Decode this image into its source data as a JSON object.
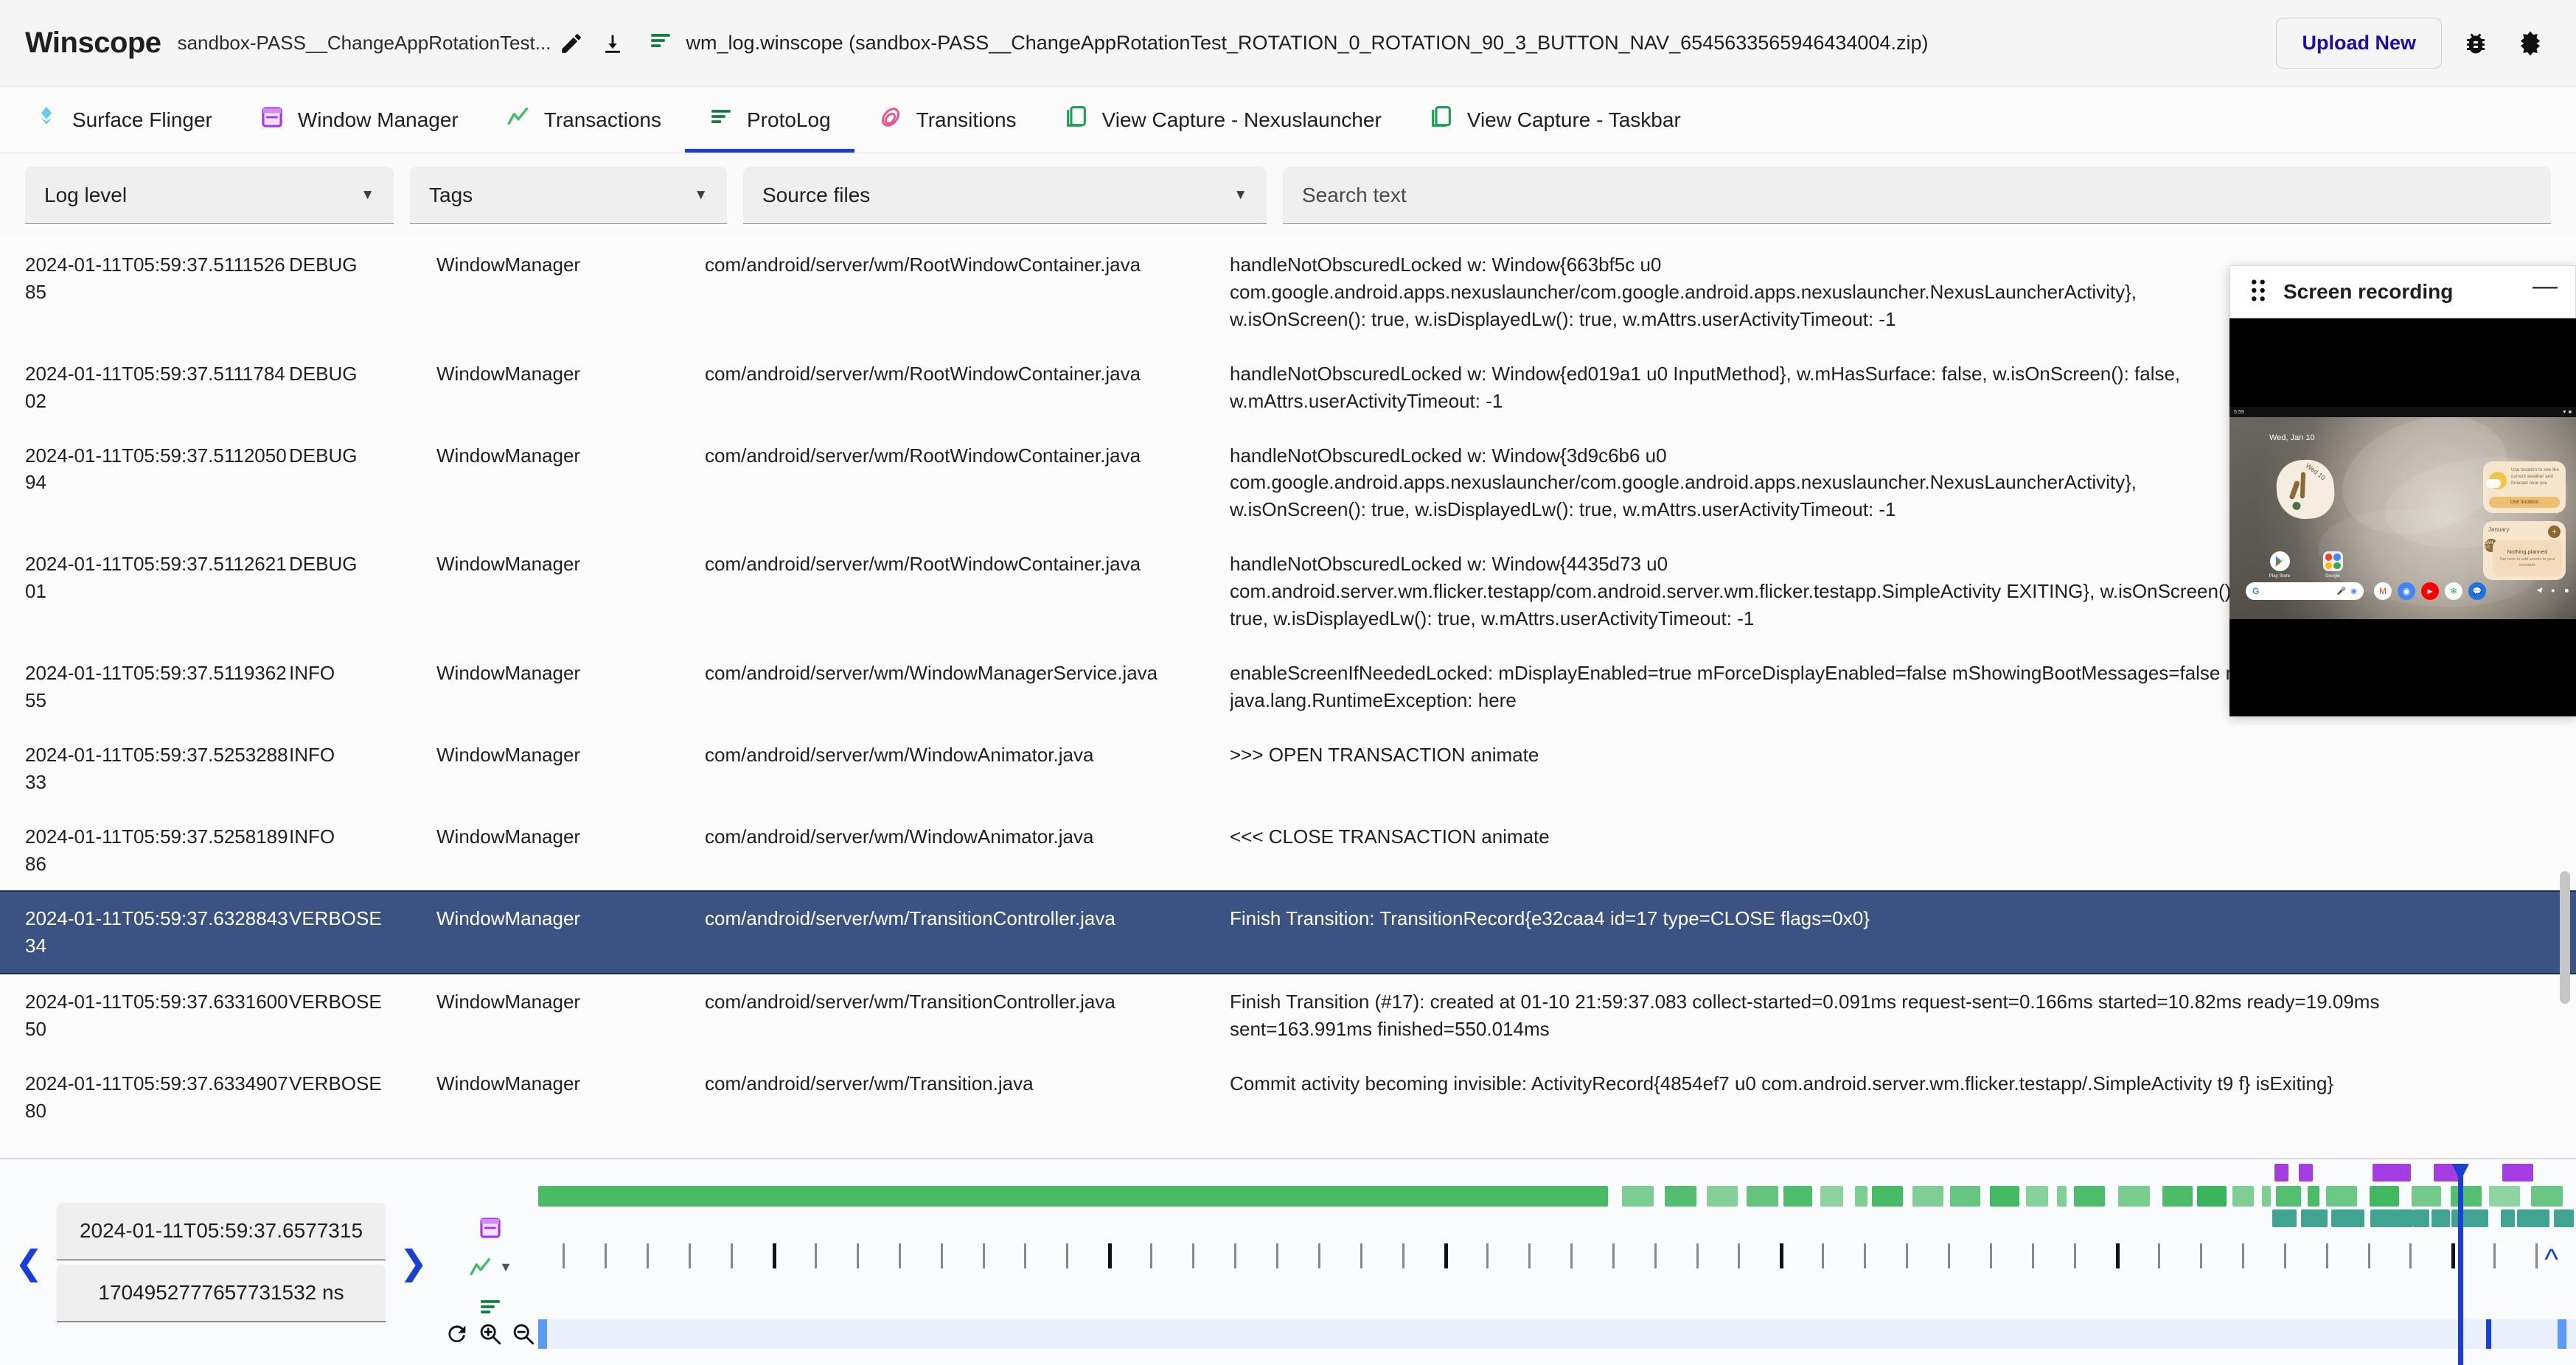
{
  "app": {
    "brand": "Winscope",
    "filename_chip": "sandbox-PASS__ChangeAppRotationTest...",
    "center_title": "wm_log.winscope (sandbox-PASS__ChangeAppRotationTest_ROTATION_0_ROTATION_90_3_BUTTON_NAV_6545633565946434004.zip)",
    "upload_label": "Upload New",
    "edit_icon": "pencil-icon",
    "download_icon": "download-icon",
    "bug_icon": "bug-report-icon",
    "theme_icon": "dark-mode-icon",
    "protolog_icon": "protolog-lines-icon"
  },
  "tabs": [
    {
      "label": "Surface Flinger",
      "icon": "surface-flinger-icon",
      "active": false
    },
    {
      "label": "Window Manager",
      "icon": "window-manager-icon",
      "active": false
    },
    {
      "label": "Transactions",
      "icon": "transactions-icon",
      "active": false
    },
    {
      "label": "ProtoLog",
      "icon": "protolog-icon",
      "active": true
    },
    {
      "label": "Transitions",
      "icon": "transitions-icon",
      "active": false
    },
    {
      "label": "View Capture - Nexuslauncher",
      "icon": "view-capture-icon",
      "active": false
    },
    {
      "label": "View Capture - Taskbar",
      "icon": "view-capture-icon",
      "active": false
    }
  ],
  "filters": {
    "log_level": "Log level",
    "tags": "Tags",
    "source_files": "Source files",
    "search_placeholder": "Search text",
    "search_value": ""
  },
  "log": {
    "rows": [
      {
        "time": "2024-01-11T05:59:37.511152685",
        "level": "DEBUG",
        "tag": "WindowManager",
        "source": "com/android/server/wm/RootWindowContainer.java",
        "message_lines": [
          "handleNotObscuredLocked w: Window{663bf5c u0",
          "com.google.android.apps.nexuslauncher/com.google.android.apps.nexuslauncher.NexusLauncherActivity},",
          "w.isOnScreen(): true, w.isDisplayedLw(): true, w.mAttrs.userActivityTimeout: -1"
        ],
        "selected": false
      },
      {
        "time": "2024-01-11T05:59:37.511178402",
        "level": "DEBUG",
        "tag": "WindowManager",
        "source": "com/android/server/wm/RootWindowContainer.java",
        "message_lines": [
          "handleNotObscuredLocked w: Window{ed019a1 u0 InputMethod}, w.mHasSurface: false, w.isOnScreen(): false,",
          "w.mAttrs.userActivityTimeout: -1"
        ],
        "selected": false
      },
      {
        "time": "2024-01-11T05:59:37.511205094",
        "level": "DEBUG",
        "tag": "WindowManager",
        "source": "com/android/server/wm/RootWindowContainer.java",
        "message_lines": [
          "handleNotObscuredLocked w: Window{3d9c6b6 u0",
          "com.google.android.apps.nexuslauncher/com.google.android.apps.nexuslauncher.NexusLauncherActivity},",
          "w.isOnScreen(): true, w.isDisplayedLw(): true, w.mAttrs.userActivityTimeout: -1"
        ],
        "selected": false
      },
      {
        "time": "2024-01-11T05:59:37.511262101",
        "level": "DEBUG",
        "tag": "WindowManager",
        "source": "com/android/server/wm/RootWindowContainer.java",
        "message_lines": [
          "handleNotObscuredLocked w: Window{4435d73 u0",
          "com.android.server.wm.flicker.testapp/com.android.server.wm.flicker.testapp.SimpleActivity EXITING}, w.isOnScreen():",
          "true, w.isDisplayedLw(): true, w.mAttrs.userActivityTimeout: -1"
        ],
        "selected": false
      },
      {
        "time": "2024-01-11T05:59:37.511936255",
        "level": "INFO",
        "tag": "WindowManager",
        "source": "com/android/server/wm/WindowManagerService.java",
        "message_lines": [
          "enableScreenIfNeededLocked: mDisplayEnabled=true mForceDisplayEnabled=false mShowingBootMessages=false mSystemBooted=true",
          "java.lang.RuntimeException: here"
        ],
        "selected": false
      },
      {
        "time": "2024-01-11T05:59:37.525328833",
        "level": "INFO",
        "tag": "WindowManager",
        "source": "com/android/server/wm/WindowAnimator.java",
        "message_lines": [
          ">>> OPEN TRANSACTION animate"
        ],
        "selected": false
      },
      {
        "time": "2024-01-11T05:59:37.525818986",
        "level": "INFO",
        "tag": "WindowManager",
        "source": "com/android/server/wm/WindowAnimator.java",
        "message_lines": [
          "<<< CLOSE TRANSACTION animate"
        ],
        "selected": false
      },
      {
        "time": "2024-01-11T05:59:37.632884334",
        "level": "VERBOSE",
        "tag": "WindowManager",
        "source": "com/android/server/wm/TransitionController.java",
        "message_lines": [
          "Finish Transition: TransitionRecord{e32caa4 id=17 type=CLOSE flags=0x0}"
        ],
        "selected": true
      },
      {
        "time": "2024-01-11T05:59:37.633160050",
        "level": "VERBOSE",
        "tag": "WindowManager",
        "source": "com/android/server/wm/TransitionController.java",
        "message_lines": [
          "Finish Transition (#17): created at 01-10 21:59:37.083 collect-started=0.091ms request-sent=0.166ms started=10.82ms ready=19.09ms",
          "sent=163.991ms finished=550.014ms"
        ],
        "selected": false
      },
      {
        "time": "2024-01-11T05:59:37.633490780",
        "level": "VERBOSE",
        "tag": "WindowManager",
        "source": "com/android/server/wm/Transition.java",
        "message_lines": [
          "Commit activity becoming invisible: ActivityRecord{4854ef7 u0 com.android.server.wm.flicker.testapp/.SimpleActivity t9 f} isExiting}"
        ],
        "selected": false
      }
    ]
  },
  "timeline": {
    "prev_icon": "chevron-left-icon",
    "next_icon": "chevron-right-icon",
    "human_time": "2024-01-11T05:59:37.6577315",
    "raw_time": "1704952777657731532 ns",
    "expand_icon": "expand-up-icon",
    "refresh_icon": "refresh-icon",
    "zoom_in_icon": "zoom-in-icon",
    "zoom_out_icon": "zoom-out-icon",
    "track_icons": [
      "window-manager-icon",
      "transactions-icon",
      "protolog-icon"
    ],
    "dropdown_icon": "chevron-down-icon",
    "cursor_pct": 94.2,
    "colors": {
      "wm_track": "#3ab55a",
      "transactions_track": "#9c27e0",
      "protolog_track": "#18907a",
      "cursor": "#1a3fd4",
      "minimap": "#eaf0fb",
      "minimap_handle": "#5b9bf8"
    }
  },
  "recording": {
    "title": "Screen recording",
    "drag_icon": "drag-handle-icon",
    "minimize_icon": "minimize-icon",
    "phone": {
      "date": "Wed, Jan 10",
      "clock_weekday": "Wed 10",
      "weather_text": "Use location to see the current weather and forecast near you",
      "weather_button": "Use location",
      "cal_month": "January",
      "cal_day": "JAN 10",
      "cal_nothing": "Nothing planned",
      "cal_tap": "Tap here to add events to your schedule",
      "apps": [
        {
          "label": "Play Store",
          "icon": "play-store-icon"
        },
        {
          "label": "Google",
          "icon": "google-folder-icon"
        }
      ],
      "dock": [
        "gmail-icon",
        "chrome-icon",
        "youtube-icon",
        "photos-icon",
        "messages-icon"
      ],
      "nav": [
        "back-nav-icon",
        "home-nav-icon",
        "recents-nav-icon"
      ]
    }
  }
}
